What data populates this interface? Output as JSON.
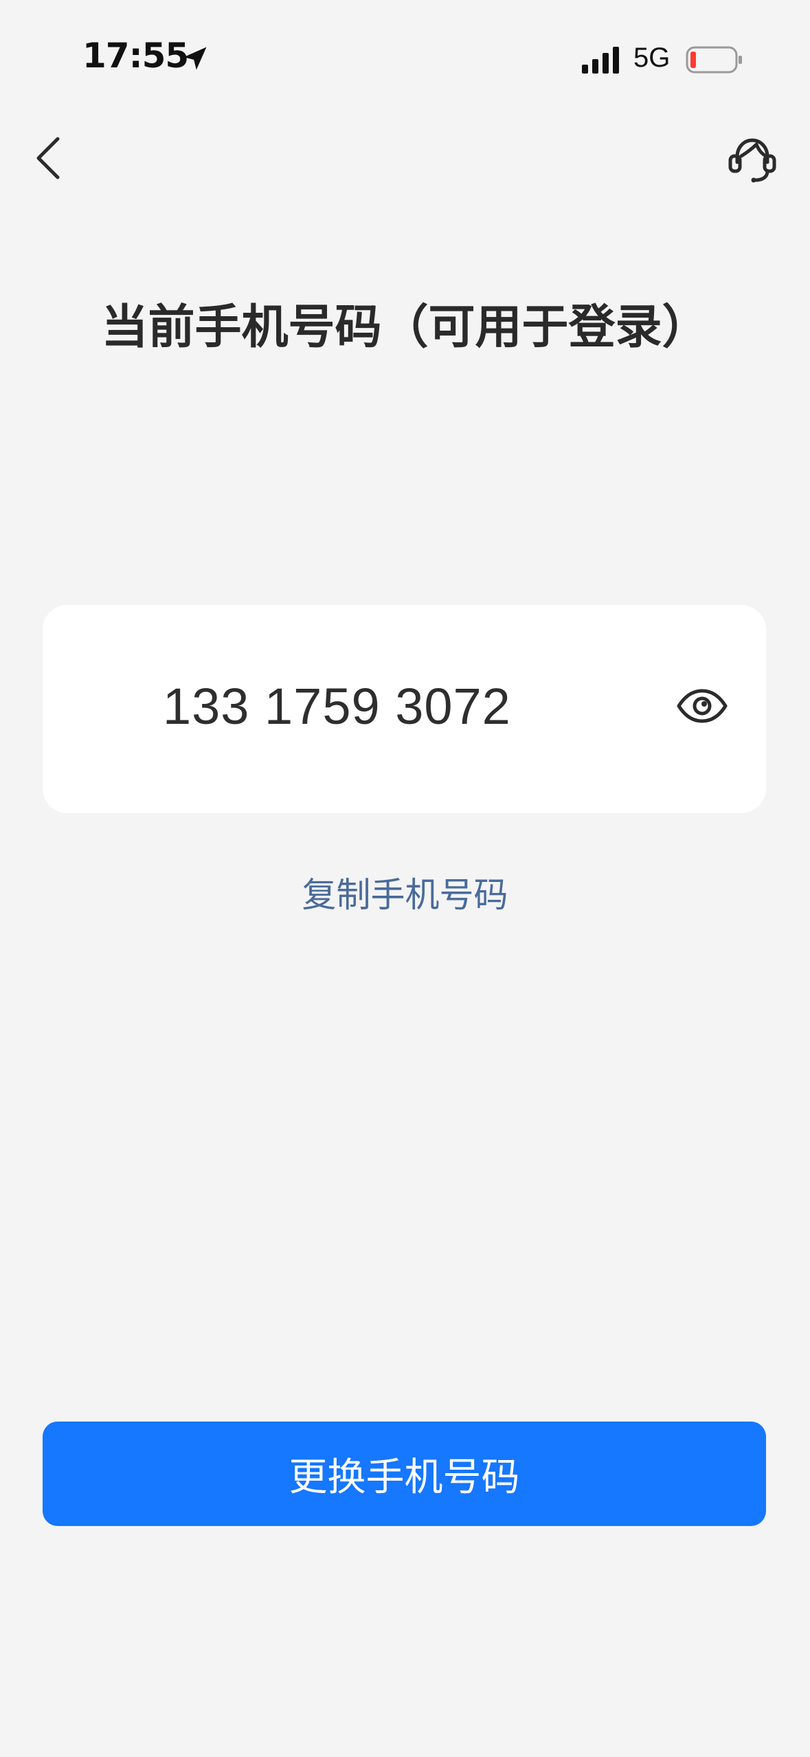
{
  "status_bar": {
    "time": "17:55",
    "network": "5G",
    "icons": [
      "location-arrow-icon",
      "signal-icon",
      "battery-icon"
    ]
  },
  "nav": {
    "back_icon": "chevron-left-icon",
    "support_icon": "customer-service-headset-icon"
  },
  "page": {
    "title": "当前手机号码（可用于登录）"
  },
  "phone_card": {
    "number": "133 1759 3072",
    "toggle_icon": "eye-icon"
  },
  "copy_link": {
    "label": "复制手机号码"
  },
  "primary_button": {
    "label": "更换手机号码"
  },
  "colors": {
    "background": "#f4f4f5",
    "card": "#ffffff",
    "primary": "#1677ff",
    "link": "#4a6b9a",
    "battery_low": "#ff3b30"
  }
}
